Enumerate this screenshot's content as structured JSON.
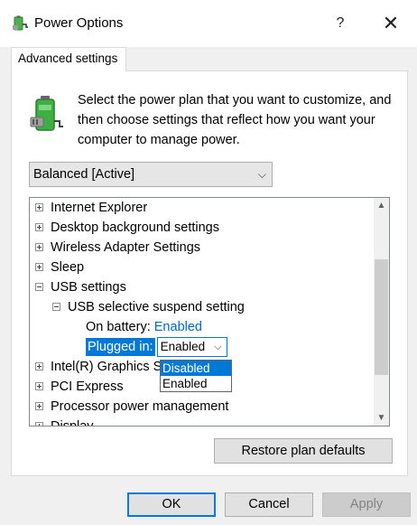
{
  "window": {
    "title": "Power Options",
    "help_glyph": "?",
    "close_glyph": "✕"
  },
  "tabs": [
    {
      "label": "Advanced settings",
      "selected": true
    }
  ],
  "intro_text": "Select the power plan that you want to customize, and then choose settings that reflect how you want your computer to manage power.",
  "plan_select": {
    "value": "Balanced [Active]",
    "chevron": "⌵"
  },
  "settings_tree": {
    "items": [
      {
        "label": "Internet Explorer",
        "expander": "plus"
      },
      {
        "label": "Desktop background settings",
        "expander": "plus"
      },
      {
        "label": "Wireless Adapter Settings",
        "expander": "plus"
      },
      {
        "label": "Sleep",
        "expander": "plus"
      },
      {
        "label": "USB settings",
        "expander": "minus"
      },
      {
        "label": "USB selective suspend setting",
        "expander": "minus"
      },
      {
        "label": "Intel(R) Graphics Settings",
        "expander": "plus"
      },
      {
        "label": "PCI Express",
        "expander": "plus"
      },
      {
        "label": "Processor power management",
        "expander": "plus"
      },
      {
        "label": "Display",
        "expander": "plus"
      }
    ],
    "on_battery": {
      "label": "On battery:",
      "value": "Enabled"
    },
    "plugged_in": {
      "label": "Plugged in:",
      "value": "Enabled",
      "chevron": "⌵",
      "options": [
        {
          "label": "Disabled",
          "highlighted": true
        },
        {
          "label": "Enabled",
          "highlighted": false
        }
      ]
    },
    "scroll_up_glyph": "▲",
    "scroll_down_glyph": "▼"
  },
  "restore_button": "Restore plan defaults",
  "buttons": {
    "ok": "OK",
    "cancel": "Cancel",
    "apply": "Apply",
    "apply_disabled": true
  },
  "colors": {
    "accent": "#0078d7",
    "link": "#0066cc",
    "window_bg": "#f0f0f0",
    "panel_bg": "#ffffff"
  },
  "icons": {
    "title": "battery-plug-icon",
    "plan": "battery-plug-icon"
  }
}
